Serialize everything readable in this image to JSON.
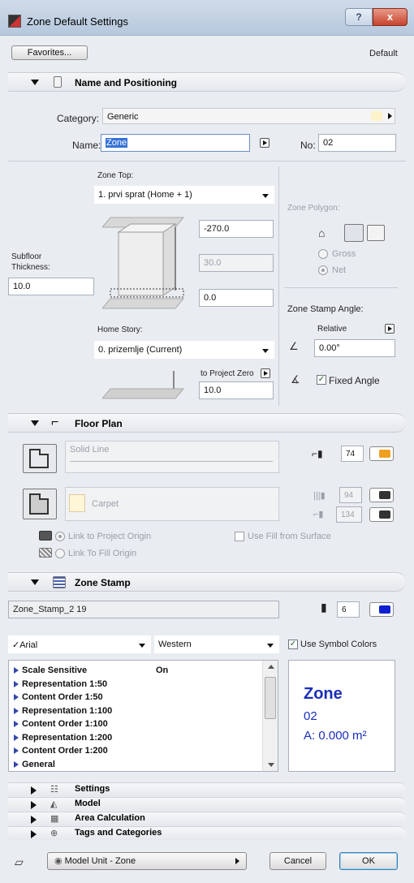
{
  "window": {
    "title": "Zone Default Settings",
    "help": "?",
    "close": "x"
  },
  "top": {
    "favorites_label": "Favorites...",
    "default_label": "Default"
  },
  "name_pos": {
    "header": "Name and Positioning",
    "category_label": "Category:",
    "category_value": "Generic",
    "name_label": "Name:",
    "name_value": "Zone",
    "no_label": "No:",
    "no_value": "02",
    "zone_top_label": "Zone Top:",
    "zone_top_value": "1. prvi sprat (Home + 1)",
    "top_offset": "-270.0",
    "height_value": "30.0",
    "bottom_offset": "0.0",
    "subfloor_label_1": "Subfloor",
    "subfloor_label_2": "Thickness:",
    "subfloor_value": "10.0",
    "home_story_label": "Home Story:",
    "home_story_value": "0. prizemlje (Current)",
    "to_project_zero_label": "to Project Zero",
    "to_project_zero_value": "10.0",
    "zone_polygon_label": "Zone Polygon:",
    "gross_label": "Gross",
    "net_label": "Net",
    "stamp_angle_label": "Zone Stamp Angle:",
    "relative_label": "Relative",
    "angle_value": "0.00°",
    "fixed_angle_label": "Fixed Angle"
  },
  "floor_plan": {
    "header": "Floor Plan",
    "line_type": "Solid Line",
    "line_pen": "74",
    "fill_name": "Carpet",
    "fill_pen_1": "94",
    "fill_pen_2": "134",
    "link_project_origin": "Link to Project Origin",
    "link_fill_origin": "Link To Fill Origin",
    "use_fill_surface": "Use Fill from Surface",
    "pen_color_orange": "#f0a020",
    "pen_color_blue": "#1020d0"
  },
  "zone_stamp": {
    "header": "Zone Stamp",
    "stamp_name": "Zone_Stamp_2 19",
    "stamp_pen": "6",
    "font": "Arial",
    "script": "Western",
    "use_symbol_colors": "Use Symbol Colors",
    "params": [
      {
        "name": "Scale Sensitive",
        "value": "On"
      },
      {
        "name": "Representation 1:50",
        "value": ""
      },
      {
        "name": "Content Order 1:50",
        "value": ""
      },
      {
        "name": "Representation 1:100",
        "value": ""
      },
      {
        "name": "Content Order 1:100",
        "value": ""
      },
      {
        "name": "Representation 1:200",
        "value": ""
      },
      {
        "name": "Content Order 1:200",
        "value": ""
      },
      {
        "name": "General",
        "value": ""
      }
    ],
    "preview_title": "Zone",
    "preview_no": "02",
    "preview_area": "A: 0.000 m²"
  },
  "collapsed": {
    "settings": "Settings",
    "model": "Model",
    "area_calc": "Area Calculation",
    "tags": "Tags and Categories"
  },
  "bottom": {
    "layer": "Model Unit - Zone",
    "cancel": "Cancel",
    "ok": "OK"
  }
}
